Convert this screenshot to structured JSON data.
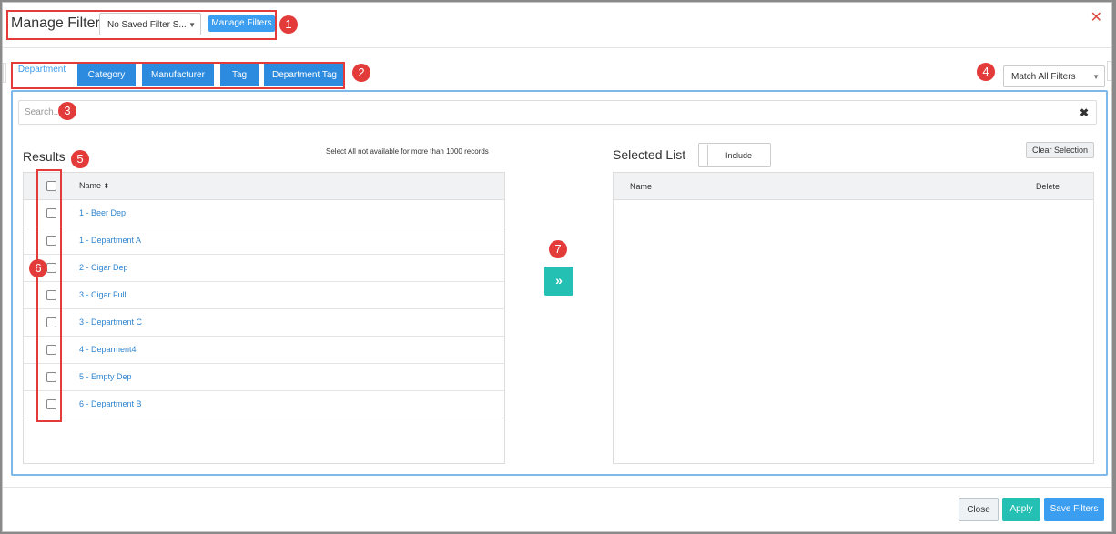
{
  "header": {
    "title": "Manage Filters",
    "saved_filter_value": "No Saved Filter S...",
    "manage_button": "Manage Filters",
    "close_glyph": "✕"
  },
  "tabs": [
    {
      "label": "Department",
      "active": true
    },
    {
      "label": "Category",
      "active": false
    },
    {
      "label": "Manufacturer",
      "active": false
    },
    {
      "label": "Tag",
      "active": false
    },
    {
      "label": "Department Tag",
      "active": false
    }
  ],
  "match_select": {
    "value": "Match All Filters"
  },
  "search": {
    "placeholder": "Search...",
    "value": "",
    "clear_glyph": "✖"
  },
  "results": {
    "heading": "Results",
    "note": "Select All not available for more than 1000 records",
    "column_name": "Name",
    "sort_glyph": "⬍",
    "items": [
      "1 - Beer Dep",
      "1 - Department A",
      "2 - Cigar Dep",
      "3 - Cigar Full",
      "3 - Department C",
      "4 - Deparment4",
      "5 - Empty Dep",
      "6 - Department B"
    ]
  },
  "selected": {
    "heading": "Selected List",
    "toggle_label": "Include",
    "clear_button": "Clear Selection",
    "column_name": "Name",
    "column_delete": "Delete"
  },
  "move_button_glyph": "»",
  "footer": {
    "close": "Close",
    "apply": "Apply",
    "save": "Save Filters"
  },
  "callouts": [
    "1",
    "2",
    "3",
    "4",
    "5",
    "6",
    "7"
  ],
  "colors": {
    "primary_blue": "#3c9ef0",
    "tab_blue": "#2d8bdf",
    "teal": "#24c0b4",
    "callout_red": "#e33a3a",
    "link_blue": "#2d84d0"
  }
}
